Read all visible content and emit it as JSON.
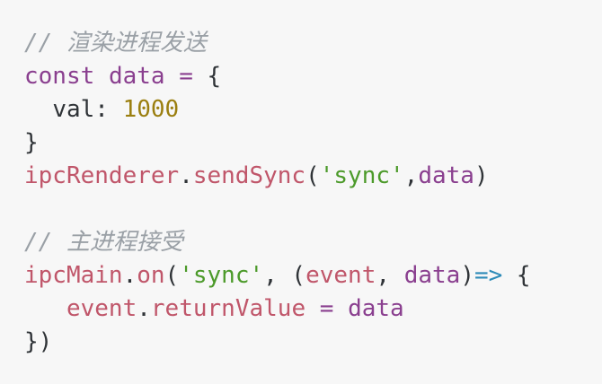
{
  "code": {
    "lines": [
      {
        "tokens": [
          {
            "type": "comment",
            "text": "// 渲染进程发送"
          }
        ]
      },
      {
        "tokens": [
          {
            "type": "kw",
            "text": "const"
          },
          {
            "type": "punc",
            "text": " "
          },
          {
            "type": "var",
            "text": "data"
          },
          {
            "type": "punc",
            "text": " "
          },
          {
            "type": "op",
            "text": "="
          },
          {
            "type": "punc",
            "text": " {"
          }
        ]
      },
      {
        "tokens": [
          {
            "type": "punc",
            "text": "  "
          },
          {
            "type": "prop",
            "text": "val"
          },
          {
            "type": "punc",
            "text": ": "
          },
          {
            "type": "num",
            "text": "1000"
          }
        ]
      },
      {
        "tokens": [
          {
            "type": "punc",
            "text": "}"
          }
        ]
      },
      {
        "tokens": [
          {
            "type": "fn",
            "text": "ipcRenderer"
          },
          {
            "type": "punc",
            "text": "."
          },
          {
            "type": "fn",
            "text": "sendSync"
          },
          {
            "type": "punc",
            "text": "("
          },
          {
            "type": "str",
            "text": "'sync'"
          },
          {
            "type": "punc",
            "text": ","
          },
          {
            "type": "var",
            "text": "data"
          },
          {
            "type": "punc",
            "text": ")"
          }
        ]
      },
      {
        "tokens": [
          {
            "type": "punc",
            "text": ""
          }
        ]
      },
      {
        "tokens": [
          {
            "type": "comment",
            "text": "// 主进程接受"
          }
        ]
      },
      {
        "tokens": [
          {
            "type": "fn",
            "text": "ipcMain"
          },
          {
            "type": "punc",
            "text": "."
          },
          {
            "type": "fn",
            "text": "on"
          },
          {
            "type": "punc",
            "text": "("
          },
          {
            "type": "str",
            "text": "'sync'"
          },
          {
            "type": "punc",
            "text": ", ("
          },
          {
            "type": "param",
            "text": "event"
          },
          {
            "type": "punc",
            "text": ", "
          },
          {
            "type": "var",
            "text": "data"
          },
          {
            "type": "punc",
            "text": ")"
          },
          {
            "type": "arrow",
            "text": "=>"
          },
          {
            "type": "punc",
            "text": " {"
          }
        ]
      },
      {
        "tokens": [
          {
            "type": "punc",
            "text": "   "
          },
          {
            "type": "param",
            "text": "event"
          },
          {
            "type": "punc",
            "text": "."
          },
          {
            "type": "fn",
            "text": "returnValue"
          },
          {
            "type": "punc",
            "text": " "
          },
          {
            "type": "op",
            "text": "="
          },
          {
            "type": "punc",
            "text": " "
          },
          {
            "type": "var",
            "text": "data"
          }
        ]
      },
      {
        "tokens": [
          {
            "type": "punc",
            "text": "})"
          }
        ]
      }
    ]
  }
}
